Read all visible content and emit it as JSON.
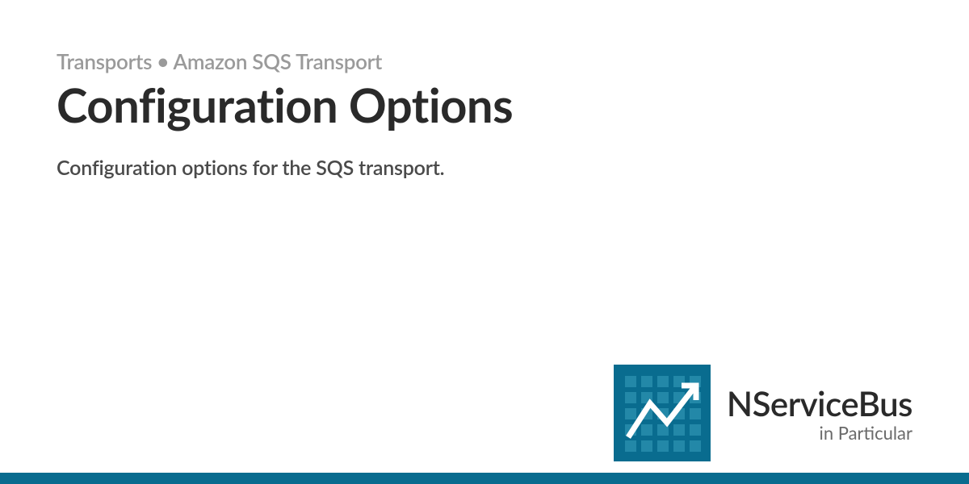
{
  "breadcrumb": {
    "item1": "Transports",
    "separator": " • ",
    "item2": "Amazon SQS Transport"
  },
  "page": {
    "title": "Configuration Options",
    "subtitle": "Configuration options for the SQS transport."
  },
  "logo": {
    "title": "NServiceBus",
    "subtitle": "in Particular"
  }
}
